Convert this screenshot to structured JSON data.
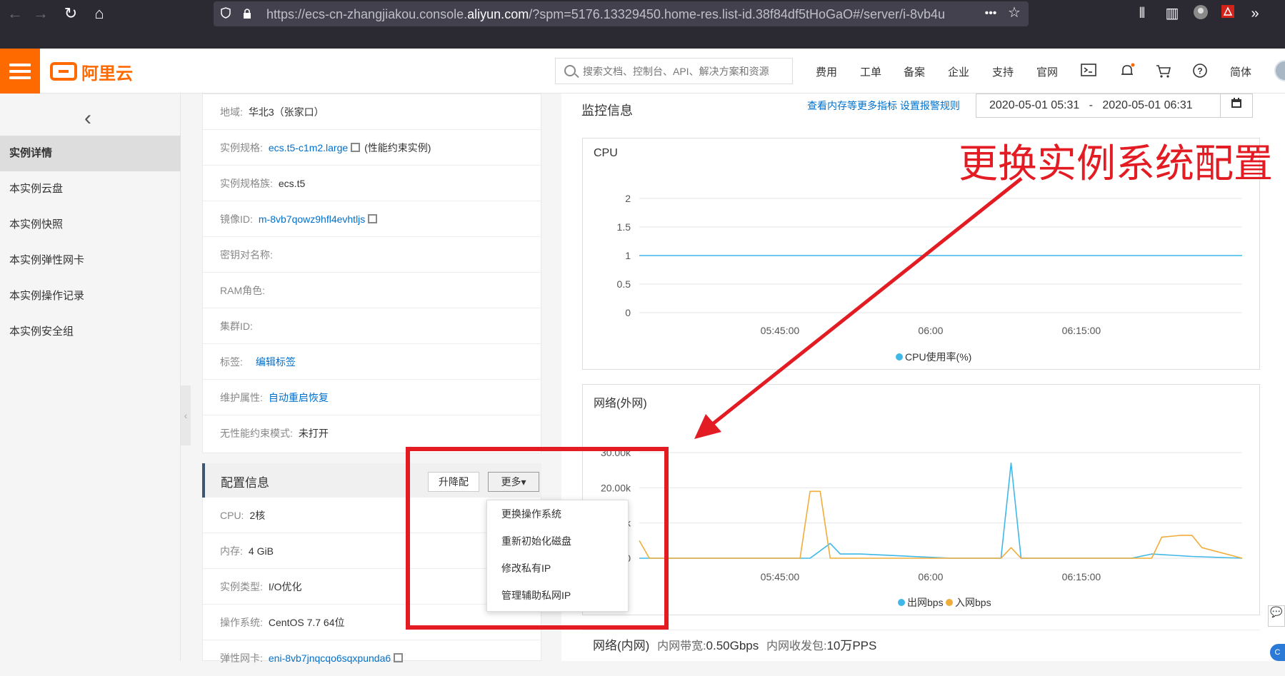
{
  "browser": {
    "url_prefix": "https://ecs-cn-zhangjiakou.console.",
    "url_domain": "aliyun.com",
    "url_suffix": "/?spm=5176.13329450.home-res.list-id.38f84df5tHoGaO#/server/i-8vb4u",
    "more_label": "•••",
    "star_label": "☆"
  },
  "topbar": {
    "logo_text": "阿里云",
    "search_placeholder": "搜索文档、控制台、API、解决方案和资源",
    "nav": [
      "费用",
      "工单",
      "备案",
      "企业",
      "支持",
      "官网"
    ],
    "lang": "简体"
  },
  "sidebar": {
    "items": [
      "实例详情",
      "本实例云盘",
      "本实例快照",
      "本实例弹性网卡",
      "本实例操作记录",
      "本实例安全组"
    ]
  },
  "detail": {
    "region_label": "地域:",
    "region_value": "华北3（张家口）",
    "spec_label": "实例规格:",
    "spec_value": "ecs.t5-c1m2.large",
    "spec_note": "(性能约束实例)",
    "family_label": "实例规格族:",
    "family_value": "ecs.t5",
    "image_label": "镜像ID:",
    "image_value": "m-8vb7qowz9hfl4evhtljs",
    "key_label": "密钥对名称:",
    "ram_label": "RAM角色:",
    "cluster_label": "集群ID:",
    "tag_label": "标签:",
    "tag_link": "编辑标签",
    "maint_label": "维护属性:",
    "maint_link": "自动重启恢复",
    "unlimited_label": "无性能约束模式:",
    "unlimited_value": "未打开"
  },
  "config": {
    "title": "配置信息",
    "resize_btn": "升降配",
    "more_btn": "更多▾",
    "cpu_label": "CPU:",
    "cpu_value": "2核",
    "mem_label": "内存:",
    "mem_value": "4 GiB",
    "type_label": "实例类型:",
    "type_value": "I/O优化",
    "os_label": "操作系统:",
    "os_value": "CentOS 7.7 64位",
    "eni_label": "弹性网卡:",
    "eni_value": "eni-8vb7jnqcqo6sqxpunda6"
  },
  "dropdown": {
    "items": [
      "更换操作系统",
      "重新初始化磁盘",
      "修改私有IP",
      "管理辅助私网IP"
    ]
  },
  "monitor": {
    "title": "监控信息",
    "links": "查看内存等更多指标 设置报警规则",
    "date_start": "2020-05-01 05:31",
    "date_sep": "-",
    "date_end": "2020-05-01 06:31"
  },
  "annotation": "更换实例系统配置",
  "chart_data": [
    {
      "type": "line",
      "title": "CPU",
      "x_ticks": [
        "05:45:00",
        "06:00",
        "06:15:00"
      ],
      "y_ticks": [
        "2",
        "1.5",
        "1",
        "0.5",
        "0"
      ],
      "ylim": [
        0,
        2
      ],
      "series": [
        {
          "name": "CPU使用率(%)",
          "color": "#3fb8e8",
          "x": [
            "05:31",
            "06:31"
          ],
          "values": [
            1,
            1
          ]
        }
      ],
      "legend": "bottom-center"
    },
    {
      "type": "line",
      "title": "网络(外网)",
      "x_ticks": [
        "05:45:00",
        "06:00",
        "06:15:00"
      ],
      "y_ticks": [
        "30.00k",
        "20.00k",
        "10.00k",
        "0"
      ],
      "ylim": [
        0,
        30000
      ],
      "series": [
        {
          "name": "出网bps",
          "color": "#3fb8e8",
          "x": [
            "05:31",
            "05:41",
            "05:48",
            "05:50",
            "05:51",
            "05:53",
            "06:02",
            "06:07",
            "06:08",
            "06:09",
            "06:10",
            "06:18",
            "06:20",
            "06:22",
            "06:26",
            "06:31"
          ],
          "values": [
            0,
            0,
            0,
            4200,
            1200,
            1200,
            0,
            0,
            27000,
            0,
            0,
            0,
            0,
            1200,
            500,
            0
          ]
        },
        {
          "name": "入网bps",
          "color": "#f0ad3a",
          "x": [
            "05:31",
            "05:32",
            "05:41",
            "05:47",
            "05:48",
            "05:49",
            "05:50",
            "06:02",
            "06:07",
            "06:08",
            "06:09",
            "06:10",
            "06:22",
            "06:23",
            "06:25",
            "06:26",
            "06:27",
            "06:31"
          ],
          "values": [
            5000,
            0,
            0,
            0,
            19000,
            19000,
            0,
            0,
            0,
            3000,
            0,
            0,
            0,
            6000,
            6500,
            6500,
            3000,
            0
          ]
        }
      ],
      "legend": "bottom-center"
    }
  ],
  "bottom": {
    "title": "网络(内网)",
    "bw_label": "内网带宽:",
    "bw_value": "0.50Gbps",
    "pps_label": "内网收发包:",
    "pps_value": "10万PPS"
  }
}
